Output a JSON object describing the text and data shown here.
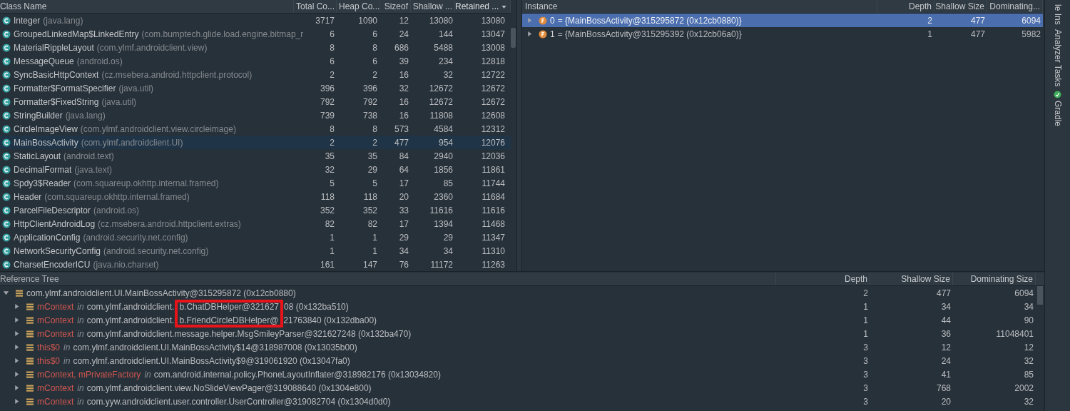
{
  "class_table": {
    "columns": [
      {
        "label": "Class Name",
        "sorted": false
      },
      {
        "label": "Total Co...",
        "sorted": false
      },
      {
        "label": "Heap Co...",
        "sorted": false
      },
      {
        "label": "Sizeof",
        "sorted": false
      },
      {
        "label": "Shallow ...",
        "sorted": false
      },
      {
        "label": "Retained ...",
        "sorted": true
      }
    ],
    "rows": [
      {
        "name": "Integer",
        "package": "(java.lang)",
        "total": "3717",
        "heap": "1090",
        "sizeof": "12",
        "shallow": "13080",
        "retained": "13080",
        "selected": false
      },
      {
        "name": "GroupedLinkedMap$LinkedEntry",
        "package": "(com.bumptech.glide.load.engine.bitmap_r",
        "total": "6",
        "heap": "6",
        "sizeof": "24",
        "shallow": "144",
        "retained": "13047",
        "selected": false
      },
      {
        "name": "MaterialRippleLayout",
        "package": "(com.ylmf.androidclient.view)",
        "total": "8",
        "heap": "8",
        "sizeof": "686",
        "shallow": "5488",
        "retained": "13008",
        "selected": false
      },
      {
        "name": "MessageQueue",
        "package": "(android.os)",
        "total": "6",
        "heap": "6",
        "sizeof": "39",
        "shallow": "234",
        "retained": "12818",
        "selected": false
      },
      {
        "name": "SyncBasicHttpContext",
        "package": "(cz.msebera.android.httpclient.protocol)",
        "total": "2",
        "heap": "2",
        "sizeof": "16",
        "shallow": "32",
        "retained": "12722",
        "selected": false
      },
      {
        "name": "Formatter$FormatSpecifier",
        "package": "(java.util)",
        "total": "396",
        "heap": "396",
        "sizeof": "32",
        "shallow": "12672",
        "retained": "12672",
        "selected": false
      },
      {
        "name": "Formatter$FixedString",
        "package": "(java.util)",
        "total": "792",
        "heap": "792",
        "sizeof": "16",
        "shallow": "12672",
        "retained": "12672",
        "selected": false
      },
      {
        "name": "StringBuilder",
        "package": "(java.lang)",
        "total": "739",
        "heap": "738",
        "sizeof": "16",
        "shallow": "11808",
        "retained": "12608",
        "selected": false
      },
      {
        "name": "CircleImageView",
        "package": "(com.ylmf.androidclient.view.circleimage)",
        "total": "8",
        "heap": "8",
        "sizeof": "573",
        "shallow": "4584",
        "retained": "12312",
        "selected": false
      },
      {
        "name": "MainBossActivity",
        "package": "(com.ylmf.androidclient.UI)",
        "total": "2",
        "heap": "2",
        "sizeof": "477",
        "shallow": "954",
        "retained": "12076",
        "selected": true
      },
      {
        "name": "StaticLayout",
        "package": "(android.text)",
        "total": "35",
        "heap": "35",
        "sizeof": "84",
        "shallow": "2940",
        "retained": "12036",
        "selected": false
      },
      {
        "name": "DecimalFormat",
        "package": "(java.text)",
        "total": "32",
        "heap": "29",
        "sizeof": "64",
        "shallow": "1856",
        "retained": "11861",
        "selected": false
      },
      {
        "name": "Spdy3$Reader",
        "package": "(com.squareup.okhttp.internal.framed)",
        "total": "5",
        "heap": "5",
        "sizeof": "17",
        "shallow": "85",
        "retained": "11744",
        "selected": false
      },
      {
        "name": "Header",
        "package": "(com.squareup.okhttp.internal.framed)",
        "total": "118",
        "heap": "118",
        "sizeof": "20",
        "shallow": "2360",
        "retained": "11684",
        "selected": false
      },
      {
        "name": "ParcelFileDescriptor",
        "package": "(android.os)",
        "total": "352",
        "heap": "352",
        "sizeof": "33",
        "shallow": "11616",
        "retained": "11616",
        "selected": false
      },
      {
        "name": "HttpClientAndroidLog",
        "package": "(cz.msebera.android.httpclient.extras)",
        "total": "82",
        "heap": "82",
        "sizeof": "17",
        "shallow": "1394",
        "retained": "11468",
        "selected": false
      },
      {
        "name": "ApplicationConfig",
        "package": "(android.security.net.config)",
        "total": "1",
        "heap": "1",
        "sizeof": "29",
        "shallow": "29",
        "retained": "11347",
        "selected": false
      },
      {
        "name": "NetworkSecurityConfig",
        "package": "(android.security.net.config)",
        "total": "1",
        "heap": "1",
        "sizeof": "34",
        "shallow": "34",
        "retained": "11310",
        "selected": false
      },
      {
        "name": "CharsetEncoderICU",
        "package": "(java.nio.charset)",
        "total": "161",
        "heap": "147",
        "sizeof": "76",
        "shallow": "11172",
        "retained": "11263",
        "selected": false
      }
    ]
  },
  "instances": {
    "columns": [
      "Instance",
      "Depth",
      "Shallow Size",
      "Dominating..."
    ],
    "rows": [
      {
        "index": "0",
        "value": "= {MainBossActivity@315295872 (0x12cb0880)}",
        "depth": "2",
        "shallow": "477",
        "dominating": "6094",
        "expanded": false,
        "selected": true
      },
      {
        "index": "1",
        "value": "= {MainBossActivity@315295392 (0x12cb06a0)}",
        "depth": "1",
        "shallow": "477",
        "dominating": "5982",
        "expanded": false,
        "selected": false
      }
    ]
  },
  "reference_tree": {
    "title": "Reference Tree",
    "columns": [
      "Depth",
      "Shallow Size",
      "Dominating Size"
    ],
    "root": {
      "text": "com.ylmf.androidclient.UI.MainBossActivity@315295872 (0x12cb0880)",
      "depth": "2",
      "shallow": "477",
      "dominating": "6094",
      "expanded": true,
      "children": [
        {
          "field": "mContext",
          "in": "in",
          "text": "com.ylmf.androidclient.",
          "marked": "b.ChatDBHelper@321627",
          "text_end": "08 (0x132ba510)",
          "depth": "1",
          "shallow": "34",
          "dominating": "34",
          "expanded": false
        },
        {
          "field": "mContext",
          "in": "in",
          "text": "com.ylmf.androidclient.",
          "marked": "b.FriendCircleDBHelper@",
          "text_end": "21763840 (0x132dba00)",
          "depth": "1",
          "shallow": "44",
          "dominating": "90",
          "expanded": false
        },
        {
          "field": "mContext",
          "in": "in",
          "text": "com.ylmf.androidclient.message.helper.MsgSmileyParser@321627248 (0x132ba470)",
          "depth": "1",
          "shallow": "36",
          "dominating": "11048401",
          "expanded": false
        },
        {
          "field": "this$0",
          "in": "in",
          "text": "com.ylmf.androidclient.UI.MainBossActivity$14@318987008 (0x13035b00)",
          "depth": "3",
          "shallow": "12",
          "dominating": "12",
          "expanded": false
        },
        {
          "field": "this$0",
          "in": "in",
          "text": "com.ylmf.androidclient.UI.MainBossActivity$9@319061920 (0x13047fa0)",
          "depth": "3",
          "shallow": "24",
          "dominating": "32",
          "expanded": false
        },
        {
          "field": "mContext, mPrivateFactory",
          "in": "in",
          "text": "com.android.internal.policy.PhoneLayoutInflater@318982176 (0x13034820)",
          "depth": "3",
          "shallow": "41",
          "dominating": "85",
          "expanded": false
        },
        {
          "field": "mContext",
          "in": "in",
          "text": "com.ylmf.androidclient.view.NoSlideViewPager@319088640 (0x1304e800)",
          "depth": "3",
          "shallow": "768",
          "dominating": "2002",
          "expanded": false
        },
        {
          "field": "mContext",
          "in": "in",
          "text": "com.yyw.androidclient.user.controller.UserController@319082704 (0x1304d0d0)",
          "depth": "3",
          "shallow": "20",
          "dominating": "32",
          "expanded": false
        }
      ]
    }
  },
  "side_toolbar": [
    {
      "label": "le Ins",
      "kind": "plain"
    },
    {
      "label": "Analyzer Tasks",
      "kind": "plain"
    },
    {
      "label": "Gradle",
      "kind": "gradle"
    }
  ]
}
